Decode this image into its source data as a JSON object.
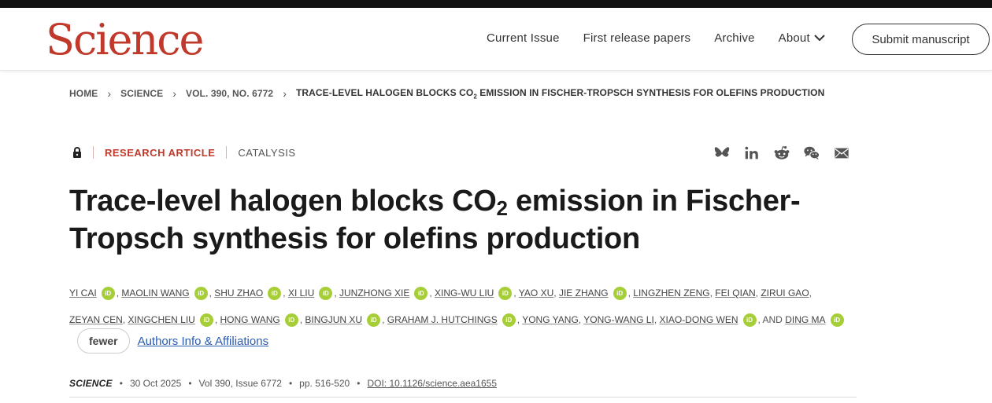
{
  "header": {
    "logo": "Science",
    "nav": [
      "Current Issue",
      "First release papers",
      "Archive"
    ],
    "about_label": "About",
    "submit_label": "Submit manuscript"
  },
  "breadcrumb": {
    "home": "HOME",
    "journal": "SCIENCE",
    "issue": "VOL. 390, NO. 6772",
    "current_pre": "TRACE-LEVEL HALOGEN BLOCKS CO",
    "current_sub": "2",
    "current_post": " EMISSION IN FISCHER-TROPSCH SYNTHESIS FOR OLEFINS PRODUCTION"
  },
  "article": {
    "type": "RESEARCH ARTICLE",
    "subject": "CATALYSIS",
    "title_pre": "Trace-level halogen blocks CO",
    "title_sub": "2",
    "title_post": " emission in Fischer-Tropsch synthesis for olefins production",
    "orcid_label": "iD",
    "authors": [
      "YI CAI",
      "MAOLIN WANG",
      "SHU ZHAO",
      "XI LIU",
      "JUNZHONG XIE",
      "XING-WU LIU",
      "YAO XU",
      "JIE ZHANG",
      "LINGZHEN ZENG",
      "FEI QIAN",
      "ZIRUI GAO",
      "ZEYAN CEN",
      "XINGCHEN LIU",
      "HONG WANG",
      "BINGJUN XU",
      "GRAHAM J. HUTCHINGS",
      "YONG YANG",
      "YONG-WANG LI",
      "XIAO-DONG WEN",
      "DING MA"
    ],
    "and_label": "AND",
    "fewer_label": "fewer",
    "affiliations_label": "Authors Info & Affiliations"
  },
  "pubinfo": {
    "journal": "SCIENCE",
    "date": "30 Oct 2025",
    "volume": "Vol 390, Issue 6772",
    "pages": "pp. 516-520",
    "doi": "DOI: 10.1126/science.aea1655"
  },
  "colors": {
    "brand": "#c0392b",
    "orcid": "#a6ce39",
    "link": "#2a5db0"
  }
}
